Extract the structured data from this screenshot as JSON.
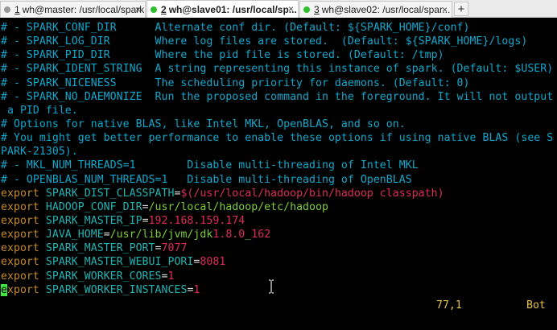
{
  "tabs": [
    {
      "num": "1",
      "label": "wh@master: /usr/local/spark",
      "dot_color": "#9a9a9a",
      "close": "×",
      "active": false
    },
    {
      "num": "2",
      "label": "wh@slave01: /usr/local/sp...",
      "dot_color": "#2fbf2f",
      "close": "×",
      "active": true
    },
    {
      "num": "3",
      "label": "wh@slave02: /usr/local/spar...",
      "dot_color": "#2fbf2f",
      "close": "×",
      "active": false
    }
  ],
  "add_tab": "+",
  "terminal": {
    "lines": [
      [
        [
          "c",
          "# - SPARK_CONF_DIR      Alternate conf dir. (Default: ${SPARK_HOME}/conf)"
        ]
      ],
      [
        [
          "c",
          "# - SPARK_LOG_DIR       Where log files are stored.  (Default: ${SPARK_HOME}/logs)"
        ]
      ],
      [
        [
          "c",
          "# - SPARK_PID_DIR       Where the pid file is stored. (Default: /tmp)"
        ]
      ],
      [
        [
          "c",
          "# - SPARK_IDENT_STRING  A string representing this instance of spark. (Default: $USER)"
        ]
      ],
      [
        [
          "c",
          "# - SPARK_NICENESS      The scheduling priority for daemons. (Default: 0)"
        ]
      ],
      [
        [
          "c",
          "# - SPARK_NO_DAEMONIZE  Run the proposed command in the foreground. It will not output"
        ]
      ],
      [
        [
          "c",
          " a PID file."
        ]
      ],
      [
        [
          "c",
          "# Options for native BLAS, like Intel MKL, OpenBLAS, and so on."
        ]
      ],
      [
        [
          "c",
          "# You might get better performance to enable these options if using native BLAS (see S"
        ]
      ],
      [
        [
          "c",
          "PARK-21305)."
        ]
      ],
      [
        [
          "c",
          "# - MKL_NUM_THREADS=1        Disable multi-threading of Intel MKL"
        ]
      ],
      [
        [
          "c",
          "# - OPENBLAS_NUM_THREADS=1   Disable multi-threading of OpenBLAS"
        ]
      ],
      [
        [
          "k",
          "export "
        ],
        [
          "v",
          "SPARK_DIST_CLASSPATH"
        ],
        [
          "s",
          "="
        ],
        [
          "r",
          "$(/usr/local/hadoop/bin/hadoop classpath)"
        ]
      ],
      [
        [
          "k",
          "export "
        ],
        [
          "v",
          "HADOOP_CONF_DIR"
        ],
        [
          "s",
          "="
        ],
        [
          "g",
          "/usr/local/hadoop/etc/hadoop"
        ]
      ],
      [
        [
          "k",
          "export "
        ],
        [
          "v",
          "SPARK_MASTER_IP"
        ],
        [
          "s",
          "="
        ],
        [
          "r",
          "192.168.159.174"
        ]
      ],
      [
        [
          "k",
          "export "
        ],
        [
          "v",
          "JAVA_HOME"
        ],
        [
          "s",
          "="
        ],
        [
          "g",
          "/usr/lib/jvm/jdk"
        ],
        [
          "r",
          "1.8.0"
        ],
        [
          "g",
          "_"
        ],
        [
          "r",
          "162"
        ]
      ],
      [
        [
          "k",
          "export "
        ],
        [
          "v",
          "SPARK_MASTER_PORT"
        ],
        [
          "s",
          "="
        ],
        [
          "r",
          "7077"
        ]
      ],
      [
        [
          "k",
          "export "
        ],
        [
          "v",
          "SPARK_MASTER_WEBUI_PORI"
        ],
        [
          "s",
          "="
        ],
        [
          "r",
          "8081"
        ]
      ],
      [
        [
          "k",
          "export "
        ],
        [
          "v",
          "SPARK_WORKER_CORES"
        ],
        [
          "s",
          "="
        ],
        [
          "r",
          "1"
        ]
      ],
      [
        [
          "cursor",
          "e"
        ],
        [
          "k",
          "xport "
        ],
        [
          "v",
          "SPARK_WORKER_INSTANCES"
        ],
        [
          "s",
          "="
        ],
        [
          "r",
          "1"
        ]
      ]
    ],
    "status_position": "77,1",
    "status_scroll": "Bot"
  }
}
